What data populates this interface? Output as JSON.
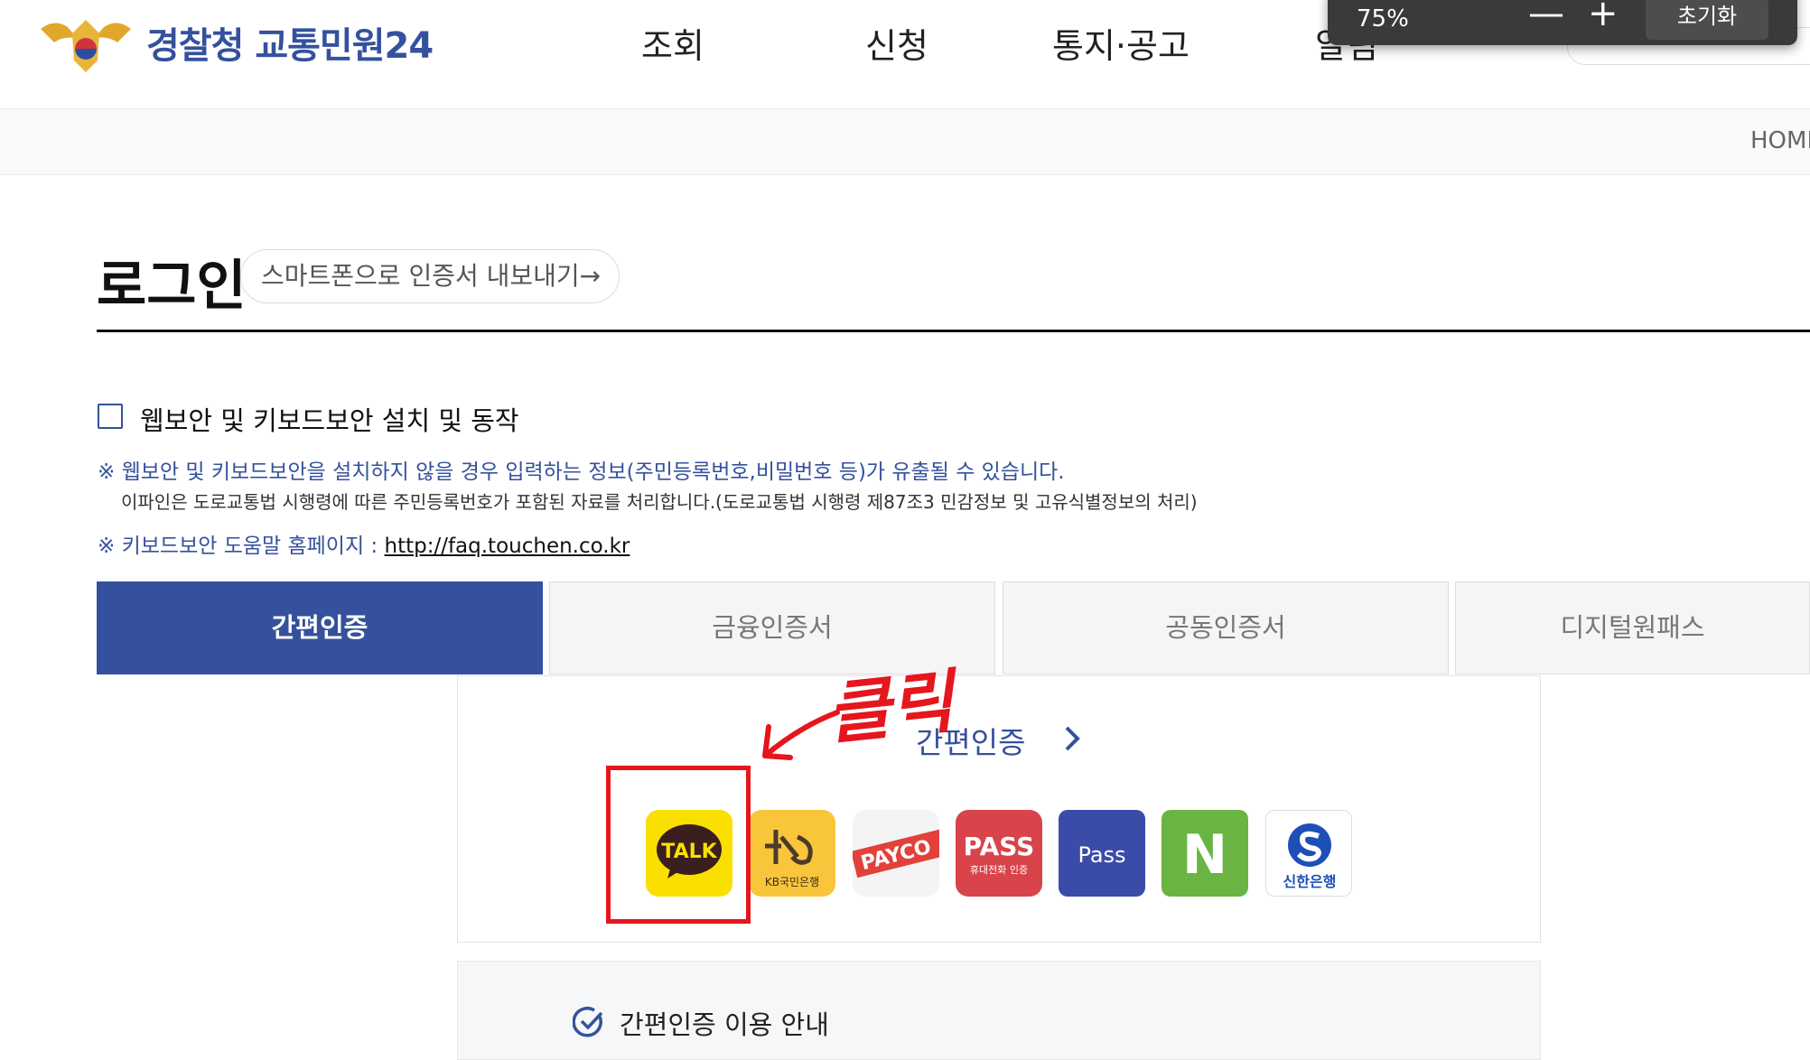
{
  "header": {
    "logo_text": "경찰청 교통민원24",
    "nav": [
      "조회",
      "신청",
      "통지·공고",
      "알림"
    ]
  },
  "zoom_popup": {
    "level": "75%",
    "zoom_out": "—",
    "zoom_in": "+",
    "reset": "초기화"
  },
  "breadcrumb": {
    "home": "HOME"
  },
  "page": {
    "title": "로그인",
    "export_link": "스마트폰으로 인증서 내보내기→"
  },
  "security": {
    "checkbox_label": "웹보안 및 키보드보안 설치 및 동작",
    "notice1": "※ 웹보안 및 키보드보안을 설치하지 않을 경우 입력하는 정보(주민등록번호,비밀번호 등)가 유출될 수 있습니다.",
    "notice2": "이파인은 도로교통법 시행령에 따른 주민등록번호가 포함된 자료를 처리합니다.(도로교통법 시행령 제87조3 민감정보 및 고유식별정보의 처리)",
    "help_prefix": "※ 키보드보안 도움말 홈페이지 : ",
    "help_link": "http://faq.touchen.co.kr"
  },
  "tabs": [
    {
      "label": "간편인증",
      "active": true
    },
    {
      "label": "금융인증서",
      "active": false
    },
    {
      "label": "공동인증서",
      "active": false
    },
    {
      "label": "디지털원패스",
      "active": false
    }
  ],
  "simple_auth": {
    "title": "간편인증",
    "providers": [
      {
        "name": "kakao",
        "label": "TALK",
        "color": "#f9e000"
      },
      {
        "name": "kb",
        "label": "KB국민은행",
        "color": "#f9c53a"
      },
      {
        "name": "payco",
        "label": "PAYCO",
        "color": "#f4f4f4"
      },
      {
        "name": "pass-mobile",
        "label": "PASS",
        "sublabel": "휴대전화 인증",
        "color": "#d9434a"
      },
      {
        "name": "pass-bank",
        "label": "Pass",
        "color": "#3b4ca8"
      },
      {
        "name": "naver",
        "label": "N",
        "color": "#6ab444"
      },
      {
        "name": "shinhan",
        "label": "신한은행",
        "color": "#ffffff"
      }
    ]
  },
  "annotation": {
    "text": "클릭",
    "color": "#e5161c"
  },
  "guide": {
    "title": "간편인증 이용 안내"
  }
}
